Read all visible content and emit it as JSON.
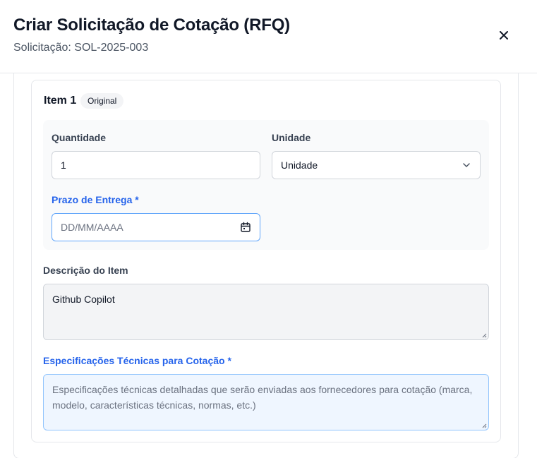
{
  "header": {
    "title": "Criar Solicitação de Cotação (RFQ)",
    "subtitle": "Solicitação: SOL-2025-003",
    "close_label": "×"
  },
  "item": {
    "title": "Item 1",
    "badge": "Original",
    "quantity": {
      "label": "Quantidade",
      "value": "1"
    },
    "unit": {
      "label": "Unidade",
      "value": "Unidade"
    },
    "deadline": {
      "label": "Prazo de Entrega *",
      "placeholder": "DD/MM/AAAA"
    },
    "description": {
      "label": "Descrição do Item",
      "value": "Github Copilot"
    },
    "specs": {
      "label": "Especificações Técnicas para Cotação *",
      "placeholder": "Especificações técnicas detalhadas que serão enviadas aos fornecedores para cotação (marca, modelo, características técnicas, normas, etc.)"
    }
  },
  "colors": {
    "required_label": "#2563eb",
    "specs_background": "#eff6ff"
  },
  "icons": [
    "close-icon",
    "chevron-down-icon",
    "calendar-icon"
  ]
}
